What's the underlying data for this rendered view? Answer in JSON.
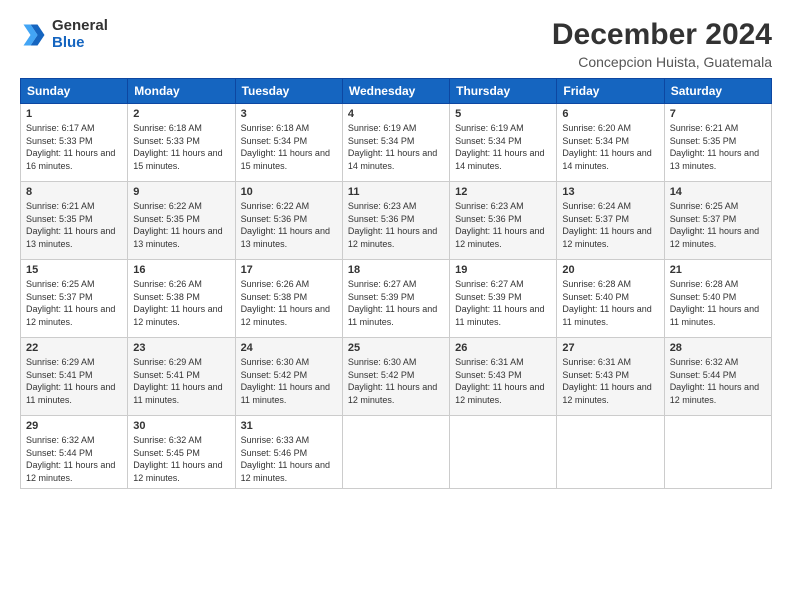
{
  "logo": {
    "general": "General",
    "blue": "Blue"
  },
  "title": "December 2024",
  "subtitle": "Concepcion Huista, Guatemala",
  "weekdays": [
    "Sunday",
    "Monday",
    "Tuesday",
    "Wednesday",
    "Thursday",
    "Friday",
    "Saturday"
  ],
  "weeks": [
    [
      {
        "day": "1",
        "sunrise": "6:17 AM",
        "sunset": "5:33 PM",
        "daylight": "11 hours and 16 minutes."
      },
      {
        "day": "2",
        "sunrise": "6:18 AM",
        "sunset": "5:33 PM",
        "daylight": "11 hours and 15 minutes."
      },
      {
        "day": "3",
        "sunrise": "6:18 AM",
        "sunset": "5:34 PM",
        "daylight": "11 hours and 15 minutes."
      },
      {
        "day": "4",
        "sunrise": "6:19 AM",
        "sunset": "5:34 PM",
        "daylight": "11 hours and 14 minutes."
      },
      {
        "day": "5",
        "sunrise": "6:19 AM",
        "sunset": "5:34 PM",
        "daylight": "11 hours and 14 minutes."
      },
      {
        "day": "6",
        "sunrise": "6:20 AM",
        "sunset": "5:34 PM",
        "daylight": "11 hours and 14 minutes."
      },
      {
        "day": "7",
        "sunrise": "6:21 AM",
        "sunset": "5:35 PM",
        "daylight": "11 hours and 13 minutes."
      }
    ],
    [
      {
        "day": "8",
        "sunrise": "6:21 AM",
        "sunset": "5:35 PM",
        "daylight": "11 hours and 13 minutes."
      },
      {
        "day": "9",
        "sunrise": "6:22 AM",
        "sunset": "5:35 PM",
        "daylight": "11 hours and 13 minutes."
      },
      {
        "day": "10",
        "sunrise": "6:22 AM",
        "sunset": "5:36 PM",
        "daylight": "11 hours and 13 minutes."
      },
      {
        "day": "11",
        "sunrise": "6:23 AM",
        "sunset": "5:36 PM",
        "daylight": "11 hours and 12 minutes."
      },
      {
        "day": "12",
        "sunrise": "6:23 AM",
        "sunset": "5:36 PM",
        "daylight": "11 hours and 12 minutes."
      },
      {
        "day": "13",
        "sunrise": "6:24 AM",
        "sunset": "5:37 PM",
        "daylight": "11 hours and 12 minutes."
      },
      {
        "day": "14",
        "sunrise": "6:25 AM",
        "sunset": "5:37 PM",
        "daylight": "11 hours and 12 minutes."
      }
    ],
    [
      {
        "day": "15",
        "sunrise": "6:25 AM",
        "sunset": "5:37 PM",
        "daylight": "11 hours and 12 minutes."
      },
      {
        "day": "16",
        "sunrise": "6:26 AM",
        "sunset": "5:38 PM",
        "daylight": "11 hours and 12 minutes."
      },
      {
        "day": "17",
        "sunrise": "6:26 AM",
        "sunset": "5:38 PM",
        "daylight": "11 hours and 12 minutes."
      },
      {
        "day": "18",
        "sunrise": "6:27 AM",
        "sunset": "5:39 PM",
        "daylight": "11 hours and 11 minutes."
      },
      {
        "day": "19",
        "sunrise": "6:27 AM",
        "sunset": "5:39 PM",
        "daylight": "11 hours and 11 minutes."
      },
      {
        "day": "20",
        "sunrise": "6:28 AM",
        "sunset": "5:40 PM",
        "daylight": "11 hours and 11 minutes."
      },
      {
        "day": "21",
        "sunrise": "6:28 AM",
        "sunset": "5:40 PM",
        "daylight": "11 hours and 11 minutes."
      }
    ],
    [
      {
        "day": "22",
        "sunrise": "6:29 AM",
        "sunset": "5:41 PM",
        "daylight": "11 hours and 11 minutes."
      },
      {
        "day": "23",
        "sunrise": "6:29 AM",
        "sunset": "5:41 PM",
        "daylight": "11 hours and 11 minutes."
      },
      {
        "day": "24",
        "sunrise": "6:30 AM",
        "sunset": "5:42 PM",
        "daylight": "11 hours and 11 minutes."
      },
      {
        "day": "25",
        "sunrise": "6:30 AM",
        "sunset": "5:42 PM",
        "daylight": "11 hours and 12 minutes."
      },
      {
        "day": "26",
        "sunrise": "6:31 AM",
        "sunset": "5:43 PM",
        "daylight": "11 hours and 12 minutes."
      },
      {
        "day": "27",
        "sunrise": "6:31 AM",
        "sunset": "5:43 PM",
        "daylight": "11 hours and 12 minutes."
      },
      {
        "day": "28",
        "sunrise": "6:32 AM",
        "sunset": "5:44 PM",
        "daylight": "11 hours and 12 minutes."
      }
    ],
    [
      {
        "day": "29",
        "sunrise": "6:32 AM",
        "sunset": "5:44 PM",
        "daylight": "11 hours and 12 minutes."
      },
      {
        "day": "30",
        "sunrise": "6:32 AM",
        "sunset": "5:45 PM",
        "daylight": "11 hours and 12 minutes."
      },
      {
        "day": "31",
        "sunrise": "6:33 AM",
        "sunset": "5:46 PM",
        "daylight": "11 hours and 12 minutes."
      },
      null,
      null,
      null,
      null
    ]
  ]
}
